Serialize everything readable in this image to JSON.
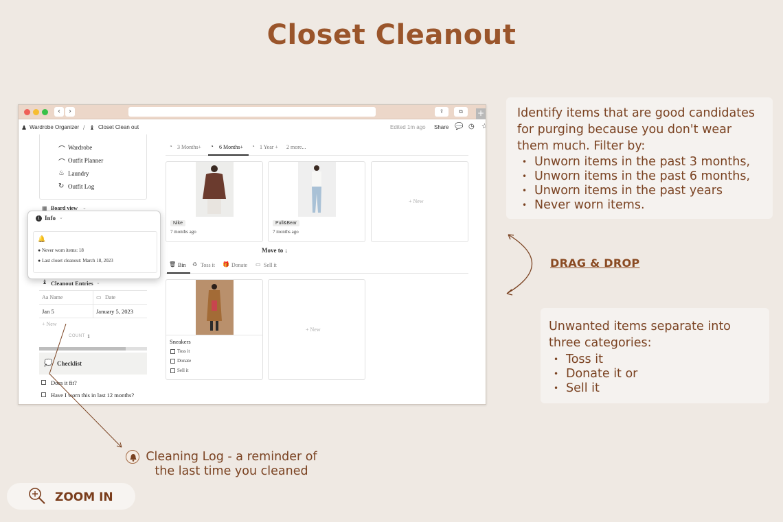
{
  "page": {
    "title": "Closet Cleanout"
  },
  "browser": {
    "breadcrumb": {
      "workspace": "Wardrobe Organizer",
      "page": "Closet Clean out",
      "separator": "/"
    },
    "status": {
      "edited": "Edited 1m ago",
      "share": "Share"
    },
    "sidebar_items": [
      "Wardrobe",
      "Outfit Planner",
      "Laundry",
      "Outfit Log"
    ],
    "board_view_label": "Board view",
    "info": {
      "label": "Info",
      "lines": [
        "● Never worn items: 18",
        "● Last closet cleanout: March 18, 2023"
      ]
    },
    "entries": {
      "title": "Cleanout Entries",
      "columns": [
        "Aa Name",
        "Date"
      ],
      "rows": [
        {
          "name": "Jan 5",
          "date": "January 5, 2023"
        }
      ],
      "new_label": "+ New",
      "count_label": "COUNT",
      "count_value": "1"
    },
    "checklist": {
      "title": "Checklist",
      "items": [
        "Does it fit?",
        "Have I worn this in last 12 months?"
      ]
    },
    "filter_tabs": [
      {
        "label": "3 Months+",
        "active": false
      },
      {
        "label": "6 Months+",
        "active": true
      },
      {
        "label": "1 Year +",
        "active": false
      },
      {
        "label": "2 more...",
        "active": false
      }
    ],
    "gallery_cards": [
      {
        "brand": "Nike",
        "time": "7 months ago"
      },
      {
        "brand": "Pull&Bear",
        "time": "7 months ago"
      }
    ],
    "new_card_label": "+ New",
    "move_to_label": "Move to ↓",
    "bin_tabs": [
      {
        "label": "Bin",
        "active": true
      },
      {
        "label": "Toss it",
        "active": false
      },
      {
        "label": "Donate",
        "active": false
      },
      {
        "label": "Sell it",
        "active": false
      }
    ],
    "bin_card": {
      "title": "Sneakers",
      "options": [
        "Toss it",
        "Donate",
        "Sell it"
      ]
    },
    "bin_new_label": "+ New"
  },
  "panel_top": {
    "text": "Identify items that are good candidates for purging because you don't wear them much. Filter by:",
    "bullets": [
      "Unworn items in the past 3 months,",
      "Unworn items in the past 6 months,",
      "Unworn items in the past years",
      "Never worn items."
    ]
  },
  "drag_drop_label": "DRAG & DROP",
  "panel_bottom": {
    "text": "Unwanted items separate into three categories:",
    "bullets": [
      "Toss it",
      "Donate it or",
      "Sell it"
    ]
  },
  "caption": "Cleaning Log - a reminder of the last time you cleaned",
  "zoom_label": "ZOOM IN",
  "colors": {
    "accent": "#9a552b",
    "text_brown": "#7a4221",
    "background": "#efe9e3",
    "chrome": "#ecd7c9"
  }
}
